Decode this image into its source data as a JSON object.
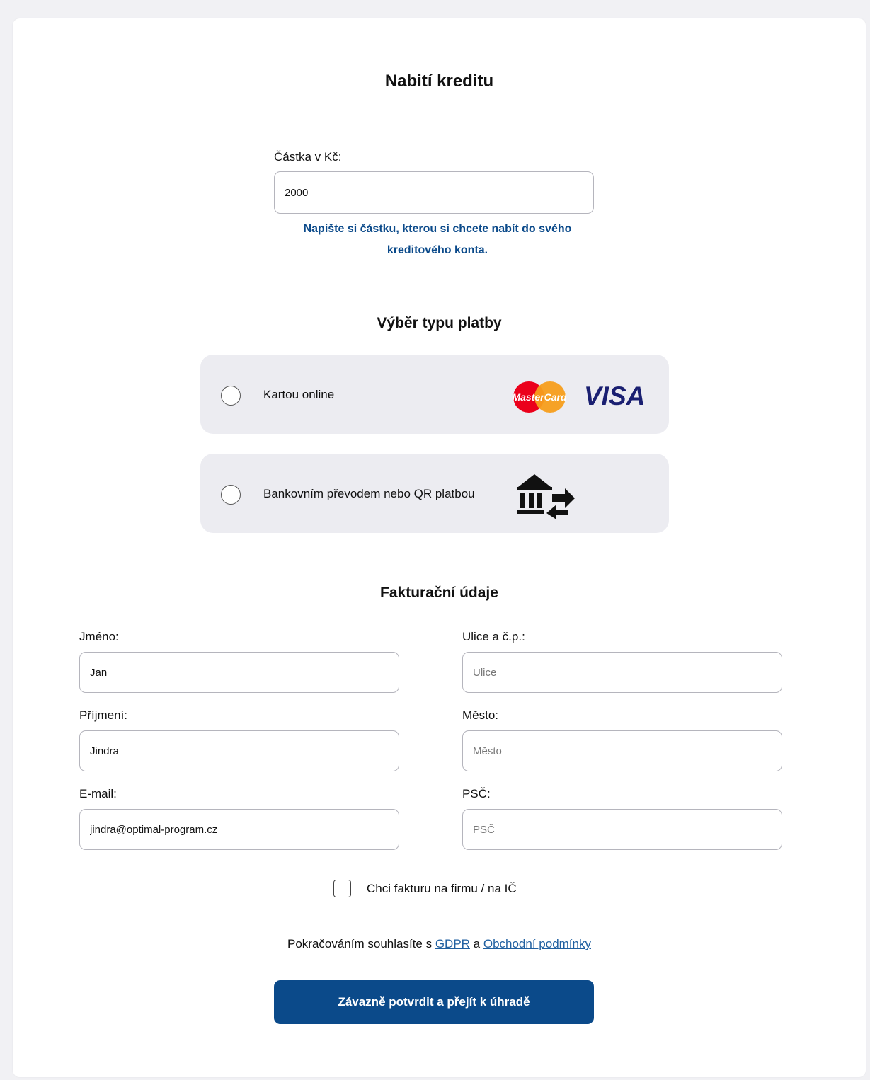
{
  "page": {
    "title": "Nabití kreditu"
  },
  "amount": {
    "label": "Částka v Kč:",
    "value": "2000",
    "hint_line1": "Napište si částku, kterou si chcete nabít do svého",
    "hint_line2": "kreditového konta."
  },
  "payment": {
    "heading": "Výběr typu platby",
    "options": [
      {
        "label": "Kartou online",
        "selected": false,
        "icons": [
          "mastercard-logo",
          "visa-logo"
        ]
      },
      {
        "label": "Bankovním převodem nebo QR platbou",
        "selected": false,
        "icons": [
          "bank-transfer-icon"
        ]
      }
    ],
    "mastercard_text": "MasterCard",
    "visa_text": "VISA"
  },
  "billing": {
    "heading": "Fakturační údaje",
    "first_name": {
      "label": "Jméno:",
      "value": "Jan"
    },
    "last_name": {
      "label": "Příjmení:",
      "value": "Jindra"
    },
    "email": {
      "label": "E-mail:",
      "value": "jindra@optimal-program.cz"
    },
    "street": {
      "label": "Ulice a č.p.:",
      "placeholder": "Ulice"
    },
    "city": {
      "label": "Město:",
      "placeholder": "Město"
    },
    "zip": {
      "label": "PSČ:",
      "placeholder": "PSČ"
    },
    "company_invoice": {
      "label": "Chci fakturu na firmu / na IČ",
      "checked": false
    }
  },
  "consent": {
    "prefix": "Pokračováním souhlasíte s ",
    "gdpr_link": "GDPR",
    "middle": " a ",
    "terms_link": "Obchodní podmínky"
  },
  "submit": {
    "label": "Závazně potvrdit a přejít k úhradě"
  },
  "colors": {
    "accent": "#0b4a8a",
    "link": "#1f5fa0",
    "option_bg": "#ececf1",
    "mastercard_red": "#eb001b",
    "mastercard_orange": "#f79e1b",
    "visa_blue": "#1a1f71"
  }
}
